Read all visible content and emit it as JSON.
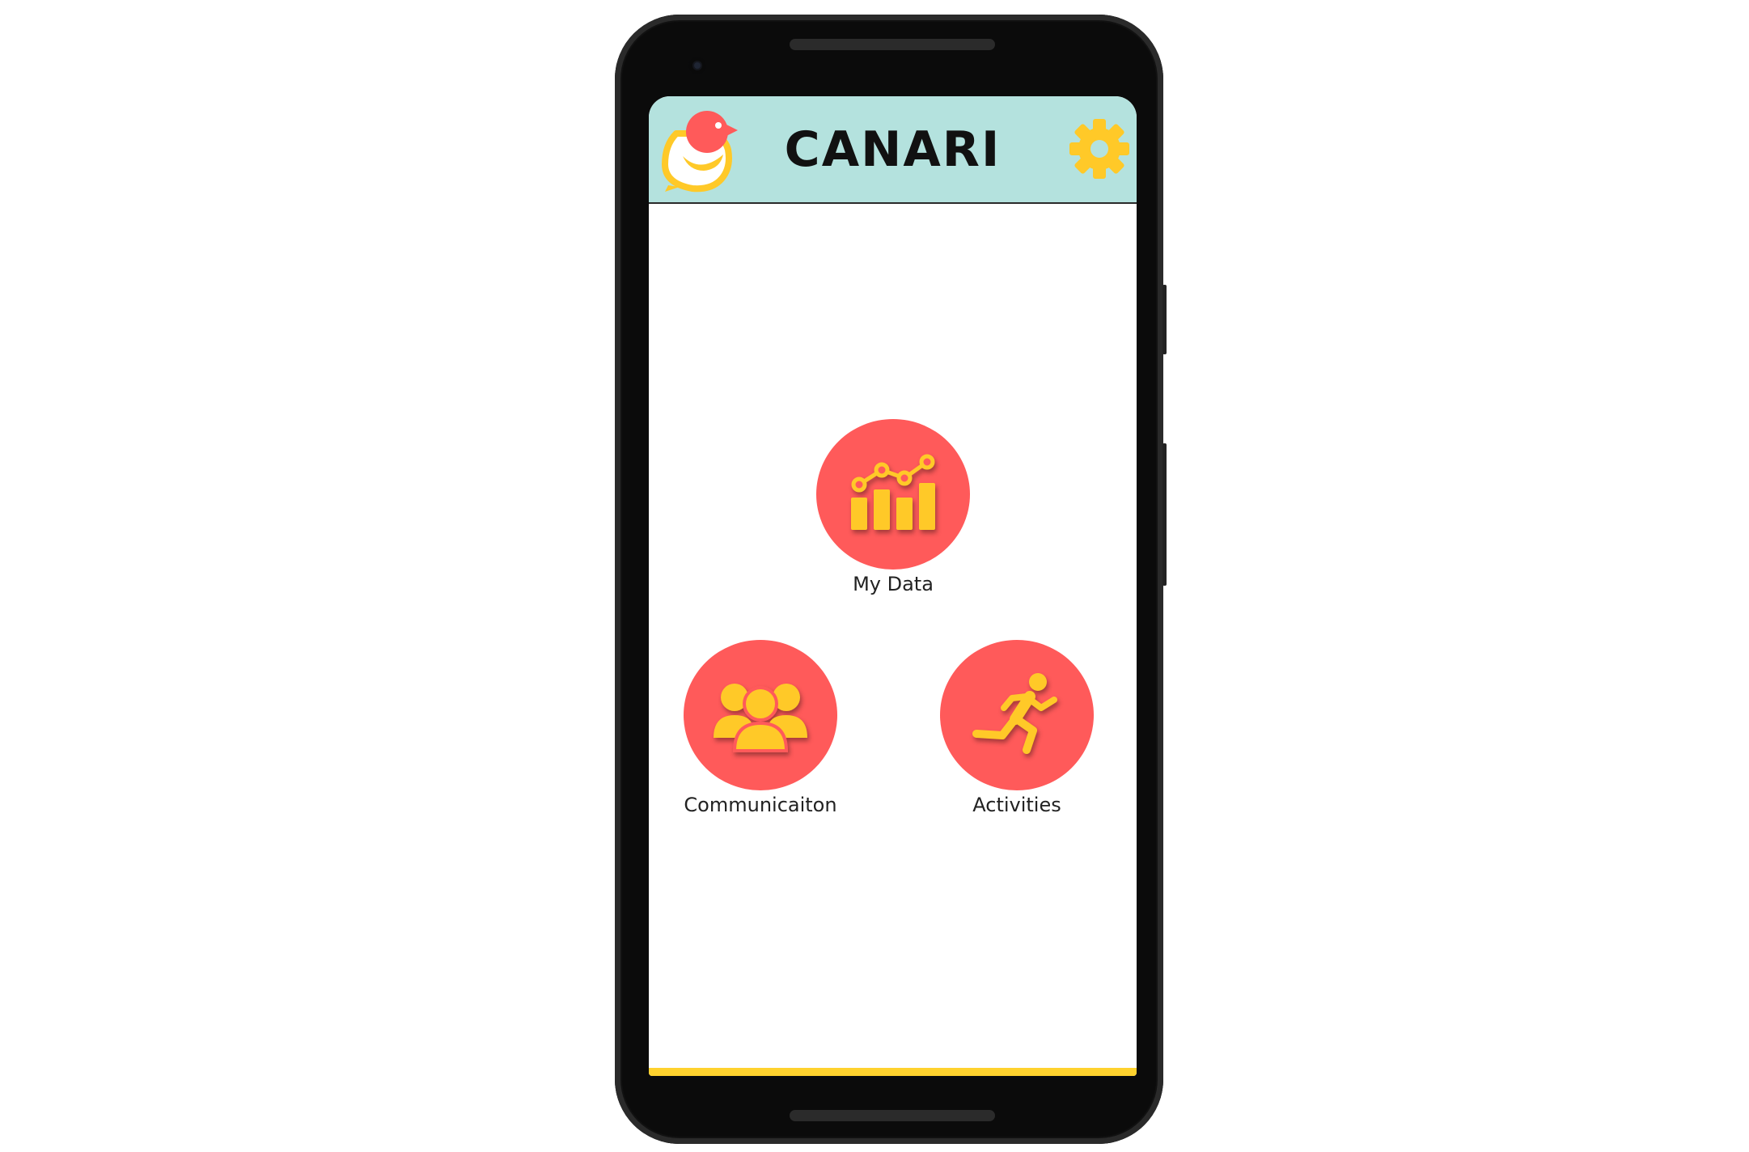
{
  "app": {
    "title": "CANARI"
  },
  "header": {
    "logo_icon": "canari-bird-logo-icon",
    "settings_icon": "gear-icon"
  },
  "menu": {
    "items": [
      {
        "label": "My Data",
        "icon": "bar-chart-trend-icon"
      },
      {
        "label": "Communicaiton",
        "icon": "group-people-icon"
      },
      {
        "label": "Activities",
        "icon": "running-person-icon"
      }
    ]
  },
  "colors": {
    "header_bg": "#b4e2de",
    "button_circle": "#ff5a5a",
    "icon_yellow": "#ffc928",
    "bottom_bar": "#ffd22e"
  }
}
